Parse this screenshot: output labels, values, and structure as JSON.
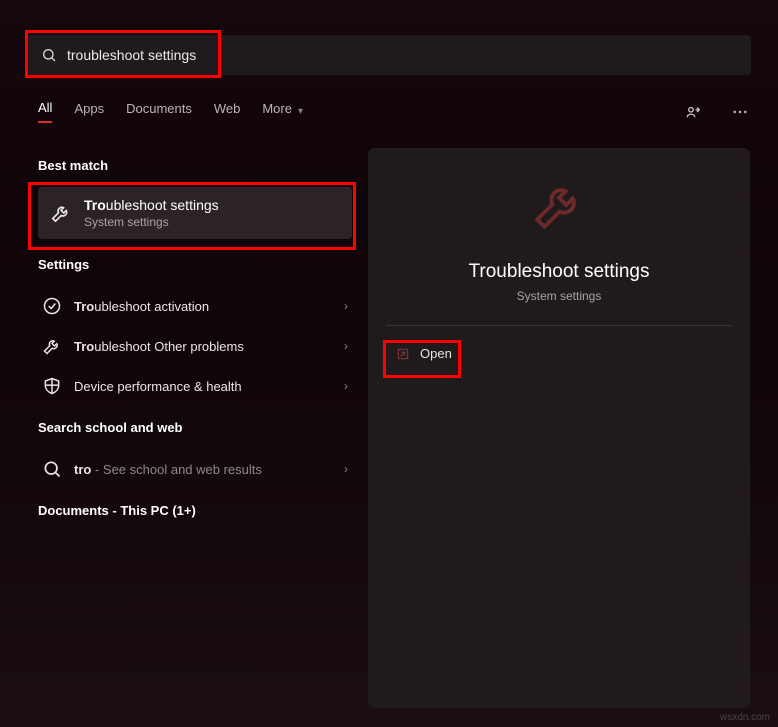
{
  "search": {
    "value": "troubleshoot settings"
  },
  "tabs": {
    "all": "All",
    "apps": "Apps",
    "documents": "Documents",
    "web": "Web",
    "more": "More"
  },
  "sections": {
    "best_match": "Best match",
    "settings": "Settings",
    "search_school_web": "Search school and web",
    "documents_pc": "Documents - This PC (1+)"
  },
  "best_result": {
    "title_prefix": "Tro",
    "title_rest": "ubleshoot settings",
    "subtitle": "System settings"
  },
  "settings_items": [
    {
      "prefix": "Tro",
      "rest": "ubleshoot activation"
    },
    {
      "prefix": "Tro",
      "rest": "ubleshoot Other problems"
    },
    {
      "prefix": "",
      "rest": "Device performance & health"
    }
  ],
  "web_item": {
    "prefix": "tro",
    "suffix": " - ",
    "hint": "See school and web results"
  },
  "right_panel": {
    "title": "Troubleshoot settings",
    "subtitle": "System settings",
    "open": "Open"
  },
  "watermark": "wsxdn.com"
}
